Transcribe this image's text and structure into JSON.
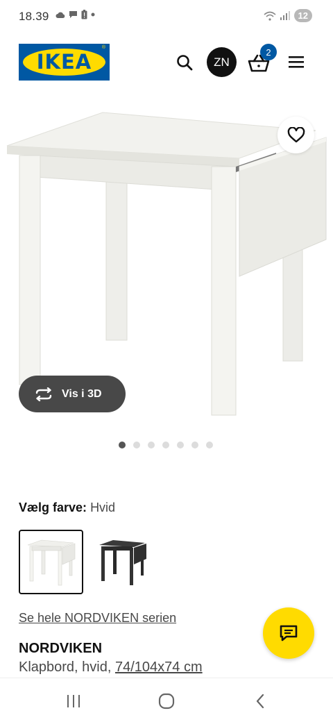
{
  "status_bar": {
    "time": "18.39",
    "battery": "12",
    "wifi_label": "5"
  },
  "header": {
    "logo_text": "IKEA",
    "logo_registered": "®",
    "avatar_initials": "ZN",
    "basket_count": "2"
  },
  "product_image": {
    "view_3d_label": "Vis i 3D",
    "carousel_total": 7,
    "carousel_active": 1
  },
  "colour": {
    "label": "Vælg farve:",
    "value": "Hvid",
    "options": [
      "Hvid",
      "Sort"
    ]
  },
  "series_link": "Se hele NORDVIKEN serien",
  "product": {
    "name": "NORDVIKEN",
    "description_prefix": "Klapbord, hvid, ",
    "dimensions": "74/104x74 cm"
  },
  "colors": {
    "ikea_blue": "#0058a3",
    "ikea_yellow": "#ffdb00",
    "dark_button": "#484848"
  }
}
